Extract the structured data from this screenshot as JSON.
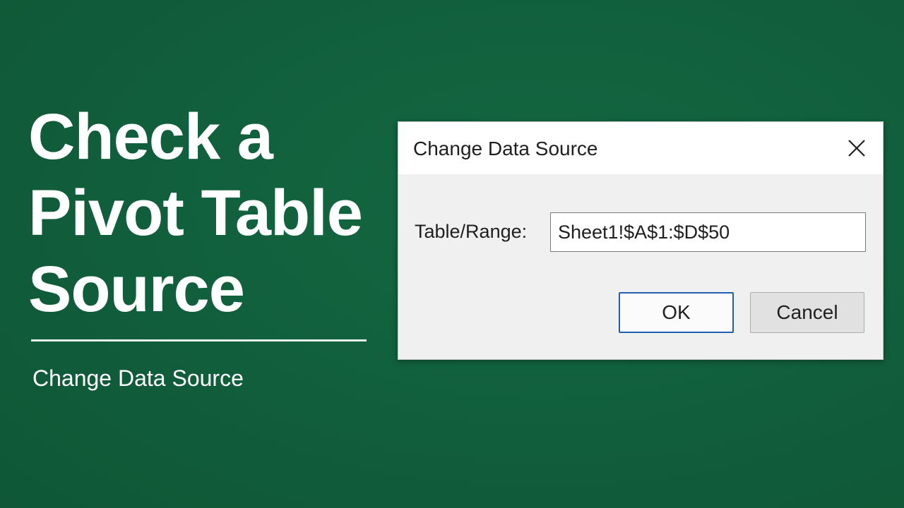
{
  "headline": {
    "line1": "Check a",
    "line2": "Pivot Table",
    "line3": "Source"
  },
  "subtitle": "Change Data Source",
  "dialog": {
    "title": "Change Data Source",
    "close_icon": "close-icon",
    "range_label": "Table/Range:",
    "range_value": "Sheet1!$A$1:$D$50",
    "ok_label": "OK",
    "cancel_label": "Cancel"
  },
  "colors": {
    "background": "#115e3c",
    "dialog_body": "#f0f0f0",
    "ok_border": "#1f5fad"
  }
}
